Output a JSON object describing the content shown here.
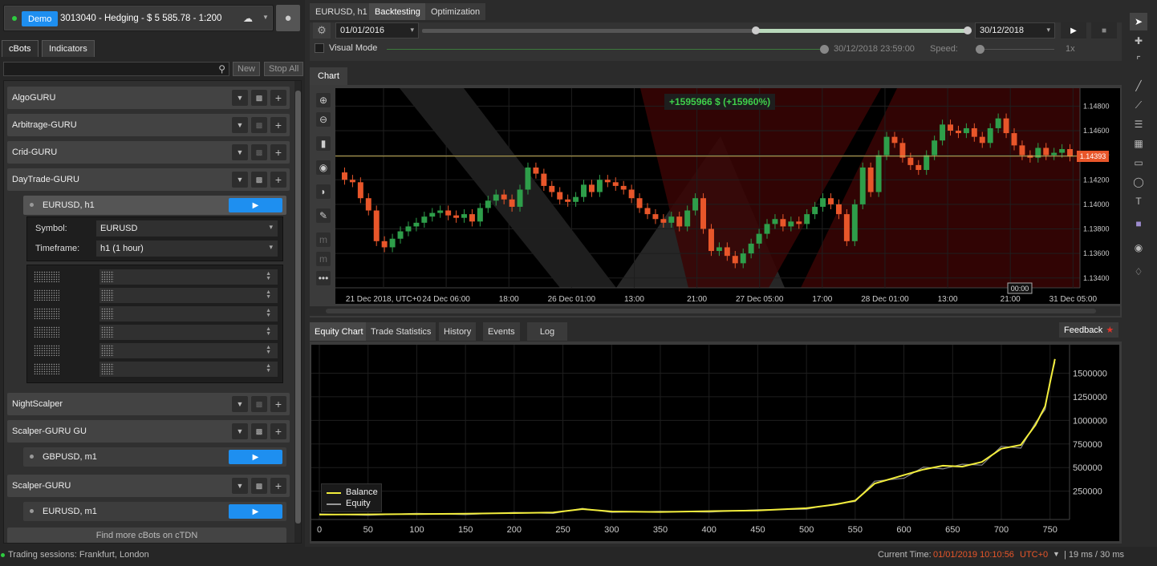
{
  "account": {
    "status_label": "Demo",
    "info": "3013040 - Hedging - $ 5 585.78 - 1:200"
  },
  "left_tabs": [
    "cBots",
    "Indicators"
  ],
  "left_toolbar": {
    "new": "New",
    "stop_all": "Stop All"
  },
  "bots": [
    {
      "name": "AlgoGURU"
    },
    {
      "name": "Arbitrage-GURU"
    },
    {
      "name": "Crid-GURU"
    },
    {
      "name": "DayTrade-GURU"
    },
    {
      "name": "NightScalper"
    },
    {
      "name": "Scalper-GURU GU"
    },
    {
      "name": "Scalper-GURU"
    }
  ],
  "instances": [
    {
      "name": "EURUSD, h1",
      "parent": "DayTrade-GURU"
    },
    {
      "name": "GBPUSD, m1",
      "parent": "Scalper-GURU GU"
    },
    {
      "name": "EURUSD, m1",
      "parent": "Scalper-GURU"
    }
  ],
  "params": [
    {
      "label": "Symbol:",
      "value": "EURUSD"
    },
    {
      "label": "Timeframe:",
      "value": "h1 (1 hour)"
    }
  ],
  "find_more": "Find more cBots on cTDN",
  "top_tabs": [
    "EURUSD, h1",
    "Backtesting",
    "Optimization"
  ],
  "backtest": {
    "from_date": "01/01/2016",
    "to_date": "30/12/2018",
    "visual_mode": "Visual Mode",
    "visual_time": "30/12/2018 23:59:00",
    "speed_label": "Speed:",
    "speed_value": "1x"
  },
  "chart_tab": "Chart",
  "bottom_tabs": [
    "Equity Chart",
    "Trade Statistics",
    "History",
    "Events",
    "Log"
  ],
  "feedback": "Feedback",
  "status": {
    "sessions": "Trading sessions:  Frankfurt, London",
    "current_label": "Current Time:",
    "current_time": "01/01/2019 10:10:56",
    "tz": "UTC+0",
    "latency": "| 19 ms / 30 ms"
  },
  "colors": {
    "accent": "#1e8ff0",
    "bull": "#2e9e4a",
    "bear": "#e8562a",
    "equity": "#f3ee3c"
  },
  "chart_data": [
    {
      "type": "candlestick",
      "symbol": "EURUSD, h1",
      "pl_label": "+1595966 $ (+15960%)",
      "current_price": "1.14393",
      "y_ticks": [
        "1.14800",
        "1.14600",
        "1.14400",
        "1.14200",
        "1.14000",
        "1.13800",
        "1.13600",
        "1.13400"
      ],
      "x_ticks": [
        "21 Dec 2018, UTC+0",
        "24 Dec 06:00",
        "18:00",
        "26 Dec 01:00",
        "13:00",
        "21:00",
        "27 Dec 05:00",
        "17:00",
        "28 Dec 01:00",
        "13:00",
        "21:00",
        "31 Dec 05:00"
      ],
      "cursor_label": "00:00",
      "close": [
        1.142,
        1.1418,
        1.1405,
        1.1395,
        1.137,
        1.1365,
        1.1372,
        1.1378,
        1.1382,
        1.1385,
        1.139,
        1.1393,
        1.1395,
        1.1391,
        1.1389,
        1.1392,
        1.1386,
        1.1397,
        1.1403,
        1.1408,
        1.1404,
        1.1398,
        1.1412,
        1.143,
        1.1425,
        1.1415,
        1.141,
        1.1404,
        1.1402,
        1.1406,
        1.1416,
        1.141,
        1.142,
        1.1418,
        1.1415,
        1.1412,
        1.1405,
        1.1397,
        1.1392,
        1.1388,
        1.1385,
        1.139,
        1.1382,
        1.1395,
        1.1405,
        1.138,
        1.1362,
        1.1365,
        1.1358,
        1.1352,
        1.136,
        1.1368,
        1.1376,
        1.1384,
        1.1388,
        1.1382,
        1.1386,
        1.1384,
        1.1392,
        1.1398,
        1.1405,
        1.14,
        1.1392,
        1.137,
        1.14,
        1.143,
        1.141,
        1.144,
        1.1455,
        1.145,
        1.1438,
        1.1432,
        1.1428,
        1.144,
        1.1452,
        1.1465,
        1.146,
        1.1458,
        1.1462,
        1.1455,
        1.145,
        1.1462,
        1.147,
        1.1458,
        1.1448,
        1.144,
        1.1438,
        1.1446,
        1.144,
        1.1442,
        1.1445,
        1.1439
      ],
      "open_note": "each candle opens at the previous close"
    },
    {
      "type": "line",
      "title": "",
      "series": [
        {
          "name": "Balance"
        },
        {
          "name": "Equity"
        }
      ],
      "x_ticks": [
        0,
        50,
        100,
        150,
        200,
        250,
        300,
        350,
        400,
        450,
        500,
        550,
        600,
        650,
        700,
        750
      ],
      "y_ticks": [
        250000,
        500000,
        750000,
        1000000,
        1250000,
        1500000
      ],
      "ylim": [
        -50000,
        1750000
      ],
      "x": [
        0,
        50,
        100,
        150,
        200,
        240,
        270,
        300,
        350,
        400,
        450,
        500,
        530,
        550,
        570,
        600,
        620,
        640,
        660,
        680,
        700,
        720,
        735,
        745,
        750,
        755
      ],
      "y": [
        2000,
        4000,
        8000,
        12000,
        18000,
        25000,
        60000,
        35000,
        30000,
        38000,
        45000,
        70000,
        110000,
        150000,
        330000,
        420000,
        480000,
        520000,
        510000,
        560000,
        700000,
        740000,
        950000,
        1150000,
        1400000,
        1650000
      ]
    }
  ]
}
